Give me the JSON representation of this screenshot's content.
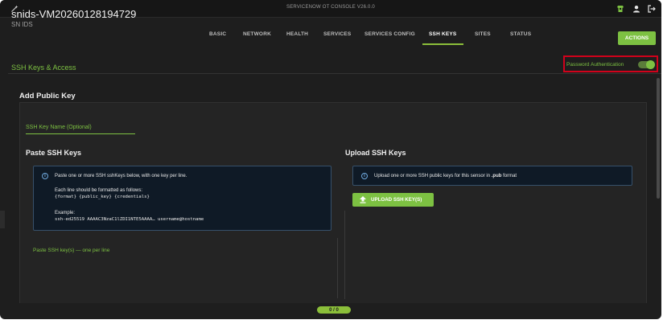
{
  "window": {
    "title": "SERVICENOW OT CONSOLE V26.0.0"
  },
  "header": {
    "device_name": "snids-VM20260128194729",
    "device_type": "SN IDS",
    "tabs": [
      {
        "label": "BASIC"
      },
      {
        "label": "NETWORK"
      },
      {
        "label": "HEALTH"
      },
      {
        "label": "SERVICES"
      },
      {
        "label": "SERVICES CONFIG"
      },
      {
        "label": "SSH KEYS",
        "active": true
      },
      {
        "label": "SITES"
      },
      {
        "label": "STATUS"
      }
    ],
    "actions_label": "ACTIONS"
  },
  "section": {
    "title": "SSH Keys & Access",
    "password_auth_label": "Password Authentication",
    "password_auth_enabled": true
  },
  "add_key": {
    "title": "Add Public Key",
    "key_name_placeholder": "SSH Key Name (Optional)",
    "paste": {
      "title": "Paste SSH Keys",
      "info_line1": "Paste one or more SSH sshKeys below, with one key per line.",
      "info_line2": "Each line should be formatted as follows:",
      "info_format": "{format} {public_key} {credentials}",
      "info_example_label": "Example:",
      "info_example": "ssh-ed25519 AAAAC3NzaC1lZDI1NTE5AAAA… username@hostname",
      "textarea_placeholder": "Paste SSH key(s) — one per line"
    },
    "upload": {
      "title": "Upload SSH Keys",
      "info_prefix": "Upload one or more SSH public keys for this sensor in ",
      "info_ext": ".pub",
      "info_suffix": " format",
      "button_label": "UPLOAD SSH KEY(S)"
    }
  },
  "pager": {
    "label": "0 / 0"
  },
  "colors": {
    "accent": "#7dc142",
    "background": "#1e1e1e",
    "info_bg": "#0f1a26",
    "highlight_box": "#d0021b"
  },
  "icons": [
    "magic-wand-icon",
    "alert-icon",
    "user-icon",
    "logout-icon",
    "info-icon",
    "upload-icon"
  ]
}
